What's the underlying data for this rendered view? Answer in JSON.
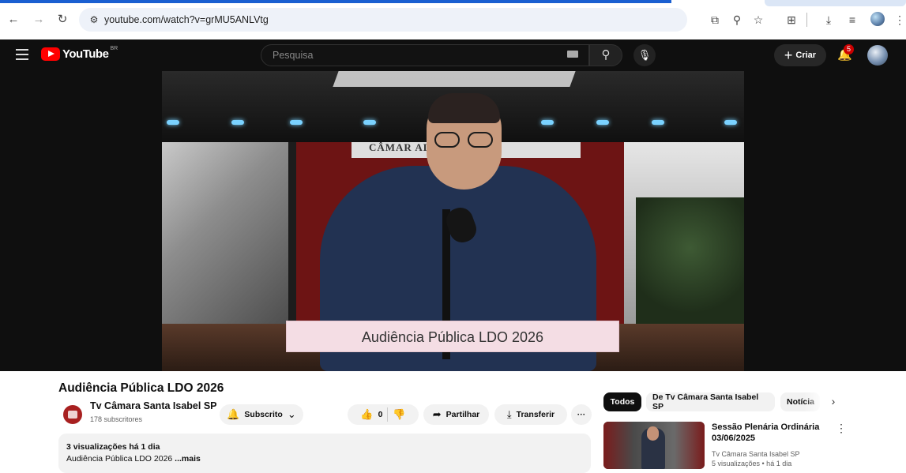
{
  "browser": {
    "url": "youtube.com/watch?v=grMU5ANLVtg",
    "icons": [
      "back-arrow",
      "forward-arrow",
      "reload",
      "site-settings",
      "cast",
      "zoom",
      "bookmark-star",
      "extensions",
      "download",
      "reading-list",
      "profile",
      "more-menu"
    ]
  },
  "youtube": {
    "logo_text": "YouTube",
    "country_code": "BR",
    "search_placeholder": "Pesquisa",
    "create_label": "Criar",
    "notifications_count": "5"
  },
  "video": {
    "overlay_caption": "Audiência Pública LDO 2026",
    "wall_text": "CÂMAR             AL",
    "title": "Audiência Pública LDO 2026"
  },
  "channel": {
    "name": "Tv Câmara Santa Isabel SP",
    "subscribers": "178 subscritores",
    "subscribe_label": "Subscrito"
  },
  "actions": {
    "like_count": "0",
    "share_label": "Partilhar",
    "download_label": "Transferir",
    "more_label": "···"
  },
  "description": {
    "meta": "3 visualizações  há 1 dia",
    "text": "Audiência Pública LDO 2026 ",
    "more": "...mais"
  },
  "sidebar": {
    "chips": [
      "Todos",
      "De Tv Câmara Santa Isabel SP",
      "Notícia"
    ],
    "recommended": {
      "title": "Sessão Plenária Ordinária 03/06/2025",
      "channel": "Tv Câmara Santa Isabel SP",
      "meta": "5 visualizações • há 1 dia"
    }
  },
  "colors": {
    "youtube_red": "#ff0000",
    "dark_bg": "#0f0f0f",
    "chrome_accent": "#1a5fd1"
  }
}
